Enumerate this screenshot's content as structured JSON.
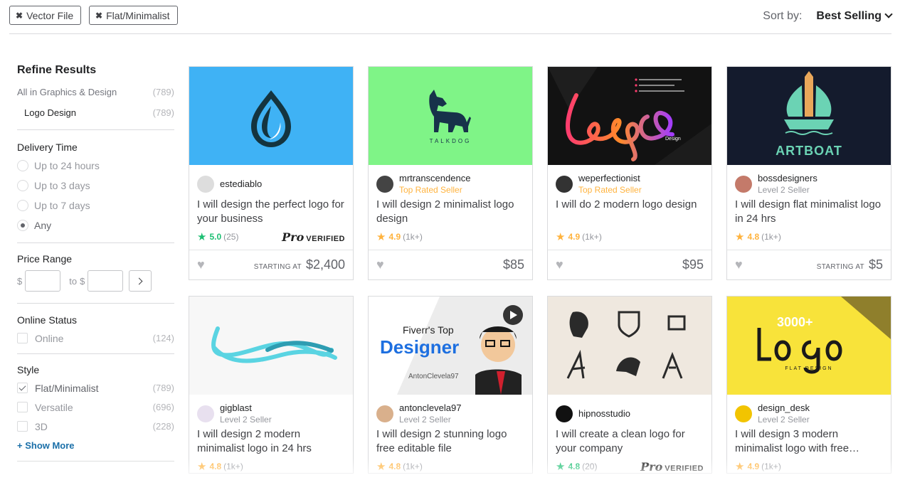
{
  "filters": {
    "chips": [
      {
        "label": "Vector File"
      },
      {
        "label": "Flat/Minimalist"
      }
    ],
    "sort_label": "Sort by:",
    "sort_value": "Best Selling"
  },
  "sidebar": {
    "title": "Refine Results",
    "category": {
      "label": "All in Graphics & Design",
      "count": "(789)"
    },
    "subcategory": {
      "label": "Logo Design",
      "count": "(789)"
    },
    "delivery": {
      "title": "Delivery Time",
      "options": [
        "Up to 24 hours",
        "Up to 3 days",
        "Up to 7 days",
        "Any"
      ],
      "selected": "Any"
    },
    "price": {
      "title": "Price Range",
      "currency": "$",
      "to": "to"
    },
    "online": {
      "title": "Online Status",
      "label": "Online",
      "count": "(124)"
    },
    "style": {
      "title": "Style",
      "items": [
        {
          "label": "Flat/Minimalist",
          "count": "(789)",
          "checked": true
        },
        {
          "label": "Versatile",
          "count": "(696)",
          "checked": false
        },
        {
          "label": "3D",
          "count": "(228)",
          "checked": false
        }
      ],
      "show_more": "+ Show More"
    }
  },
  "gigs": [
    {
      "seller": "estediablo",
      "level": "",
      "title": "I will design the perfect logo for your business",
      "rating": "5.0",
      "reviews": "(25)",
      "pro": true,
      "pro_label": "VERIFIED",
      "starting_at": "STARTING AT",
      "price": "$2,400",
      "image": "blue-drop-logo",
      "star_color": "#1dbf73"
    },
    {
      "seller": "mrtranscendence",
      "level": "Top Rated Seller",
      "title": "I will design 2 minimalist logo design",
      "rating": "4.9",
      "reviews": "(1k+)",
      "pro": false,
      "starting_at": "",
      "price": "$85",
      "image": "talkdog-logo",
      "image_text": "TALKDOG",
      "star_color": "#ffb33e"
    },
    {
      "seller": "weperfectionist",
      "level": "Top Rated Seller",
      "title": "I will do 2 modern logo design",
      "rating": "4.9",
      "reviews": "(1k+)",
      "pro": false,
      "starting_at": "",
      "price": "$95",
      "image": "gradient-logo-script",
      "image_text": "Design",
      "star_color": "#ffb33e"
    },
    {
      "seller": "bossdesigners",
      "level": "Level 2 Seller",
      "title": "I will design flat minimalist logo in 24 hrs",
      "rating": "4.8",
      "reviews": "(1k+)",
      "pro": false,
      "starting_at": "STARTING AT",
      "price": "$5",
      "image": "artboat-logo",
      "image_text": "ARTBOAT",
      "star_color": "#ffb33e"
    },
    {
      "seller": "gigblast",
      "level": "Level 2 Seller",
      "title": "I will design 2 modern minimalist logo in 24 hrs",
      "rating": "4.8",
      "reviews": "(1k+)",
      "pro": false,
      "image": "cyan-ribbon-logo",
      "star_color": "#ffb33e"
    },
    {
      "seller": "antonclevela97",
      "level": "Level 2 Seller",
      "title": "I will design 2 stunning logo free editable file",
      "rating": "4.8",
      "reviews": "(1k+)",
      "pro": false,
      "image": "fiverr-top-designer",
      "image_text_small": "Fiverr's Top",
      "image_text_big": "Designer",
      "image_text_sig": "AntonClevela97",
      "star_color": "#ffb33e"
    },
    {
      "seller": "hipnosstudio",
      "level": "",
      "title": "I will create a clean logo for your company",
      "rating": "4.8",
      "reviews": "(20)",
      "pro": true,
      "pro_label": "VERIFIED",
      "image": "icon-logos-grid",
      "star_color": "#1dbf73"
    },
    {
      "seller": "design_desk",
      "level": "Level 2 Seller",
      "title": "I will design 3 modern minimalist logo with free…",
      "rating": "4.9",
      "reviews": "(1k+)",
      "pro": false,
      "image": "yellow-flat-design",
      "image_text": "3000+",
      "image_text_sub": "FLAT DESIGN",
      "star_color": "#ffb33e"
    }
  ],
  "colors": {
    "accent_green": "#1dbf73",
    "star_gold": "#ffb33e",
    "link_blue": "#1a6fa8"
  }
}
